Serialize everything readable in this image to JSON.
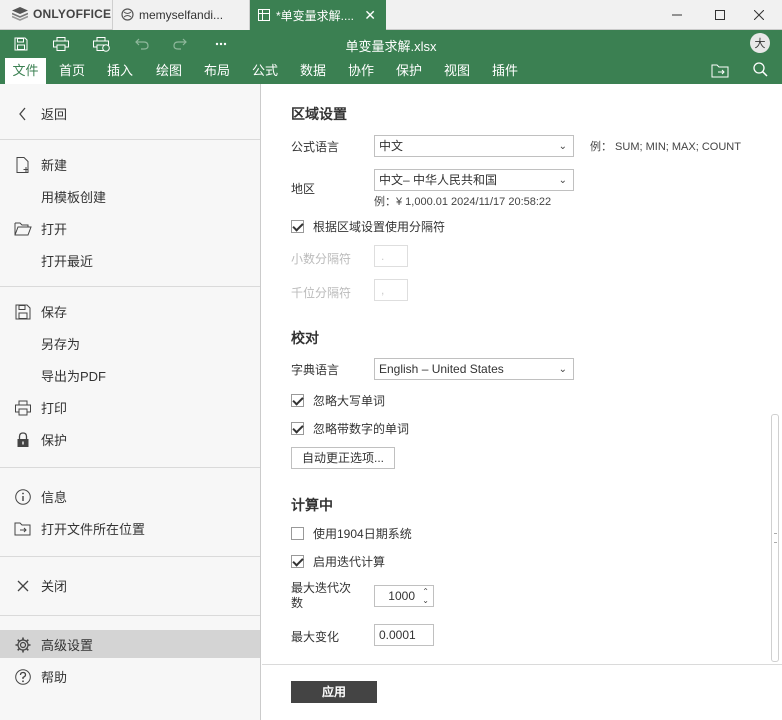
{
  "app": {
    "logo_text": "ONLYOFFICE"
  },
  "tabs": [
    {
      "label": "memyselfandi..."
    },
    {
      "label": "*单变量求解...."
    }
  ],
  "window_controls": {
    "minimize": "─",
    "maximize": "☐",
    "close": "✕"
  },
  "document_title": "单变量求解.xlsx",
  "user_initial": "大",
  "menu": {
    "items": [
      "文件",
      "首页",
      "插入",
      "绘图",
      "布局",
      "公式",
      "数据",
      "协作",
      "保护",
      "视图",
      "插件"
    ],
    "active_index": 0
  },
  "sidebar": {
    "back": "返回",
    "new": "新建",
    "create_from_template": "用模板创建",
    "open": "打开",
    "open_recent": "打开最近",
    "save": "保存",
    "save_as": "另存为",
    "export_pdf": "导出为PDF",
    "print": "打印",
    "protect": "保护",
    "info": "信息",
    "open_location": "打开文件所在位置",
    "close": "关闭",
    "advanced_settings": "高级设置",
    "help": "帮助"
  },
  "regional": {
    "title": "区域设置",
    "formula_language_label": "公式语言",
    "formula_language_value": "中文",
    "formula_example": "例：  SUM; MIN; MAX; COUNT",
    "region_label": "地区",
    "region_value": "中文– 中华人民共和国",
    "region_example": "例：¥ 1,000.01 2024/11/17 20:58:22",
    "use_separators_label": "根据区域设置使用分隔符",
    "use_separators_checked": true,
    "decimal_sep_label": "小数分隔符",
    "decimal_sep_value": ".",
    "thousands_sep_label": "千位分隔符",
    "thousands_sep_value": ","
  },
  "proofing": {
    "title": "校对",
    "dictionary_label": "字典语言",
    "dictionary_value": "English – United States",
    "ignore_upper_label": "忽略大写单词",
    "ignore_upper_checked": true,
    "ignore_numbers_label": "忽略带数字的单词",
    "ignore_numbers_checked": true,
    "autocorrect_button": "自动更正选项..."
  },
  "calculation": {
    "title": "计算中",
    "date1904_label": "使用1904日期系统",
    "date1904_checked": false,
    "iterative_label": "启用迭代计算",
    "iterative_checked": true,
    "max_iterations_label": "最大迭代次数",
    "max_iterations_value": "1000",
    "max_change_label": "最大变化",
    "max_change_value": "0.0001"
  },
  "apply_button": "应用",
  "colors": {
    "brand": "#3b8052",
    "sidebar_bg": "#f7f7f7",
    "selected_bg": "#d4d4d4"
  }
}
